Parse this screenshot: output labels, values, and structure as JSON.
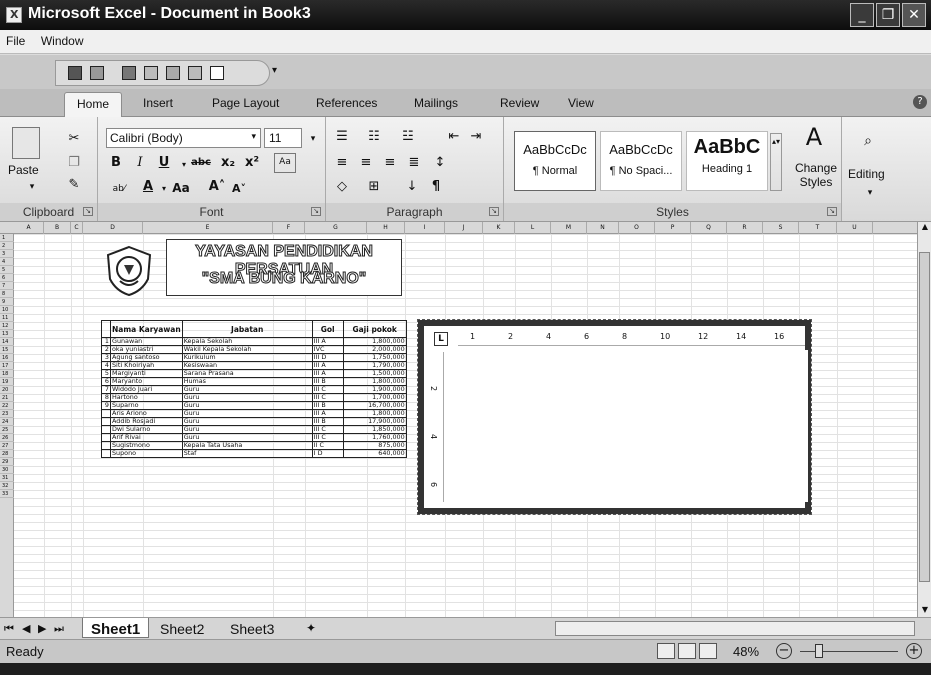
{
  "window": {
    "title": "Microsoft Excel - Document in Book3"
  },
  "menu": [
    "File",
    "Window"
  ],
  "ribbon_tabs": [
    "Home",
    "Insert",
    "Page Layout",
    "References",
    "Mailings",
    "Review",
    "View"
  ],
  "clipboard": {
    "paste": "Paste",
    "label": "Clipboard"
  },
  "font": {
    "name": "Calibri (Body)",
    "size": "11",
    "label": "Font"
  },
  "paragraph": {
    "label": "Paragraph"
  },
  "styles": {
    "items": [
      {
        "sample": "AaBbCcDc",
        "name": "¶ Normal"
      },
      {
        "sample": "AaBbCcDc",
        "name": "¶ No Spaci..."
      },
      {
        "sample": "AaBbC",
        "name": "Heading 1"
      }
    ],
    "change_styles": "Change Styles",
    "label": "Styles"
  },
  "editing": {
    "label": "Editing"
  },
  "columns": [
    "A",
    "B",
    "C",
    "D",
    "E",
    "F",
    "G",
    "H",
    "I",
    "J",
    "K",
    "L",
    "M",
    "N",
    "O",
    "P",
    "Q",
    "R",
    "S",
    "T",
    "U"
  ],
  "banner": {
    "line1": "YAYASAN PENDIDIKAN PERSATUAN",
    "line2": "\"SMA BUNG KARNO\""
  },
  "table": {
    "headers": [
      "",
      "Nama Karyawan",
      "Jabatan",
      "Gol",
      "Gaji pokok"
    ],
    "rows": [
      [
        "1",
        "Gunawan",
        "Kepala Sekolah",
        "III A",
        "1,800,000"
      ],
      [
        "2",
        "oka yuniastri",
        "Wakil Kepala Sekolah",
        "IVC",
        "2,000,000"
      ],
      [
        "3",
        "Agung santoso",
        "Kurikulum",
        "III D",
        "1,750,000"
      ],
      [
        "4",
        "Siti Khoiriyah",
        "Kesiswaan",
        "III A",
        "1,790,000"
      ],
      [
        "5",
        "Margiyanti",
        "Sarana Prasana",
        "III A",
        "1,500,000"
      ],
      [
        "6",
        "Maryanto",
        "Humas",
        "III B",
        "1,800,000"
      ],
      [
        "7",
        "Widodo Juari",
        "Guru",
        "III C",
        "1,900,000"
      ],
      [
        "8",
        "Hartono",
        "Guru",
        "III C",
        "1,700,000"
      ],
      [
        "9",
        "Suparno",
        "Guru",
        "III B",
        "16,700,000"
      ],
      [
        "",
        "Aris Ariono",
        "Guru",
        "III A",
        "1,800,000"
      ],
      [
        "",
        "Addib Rosjadi",
        "Guru",
        "III B",
        "17,900,000"
      ],
      [
        "",
        "Dwi Sularno",
        "Guru",
        "III C",
        "1,850,000"
      ],
      [
        "",
        "Arif Rivai",
        "Guru",
        "III C",
        "1,760,000"
      ],
      [
        "",
        "Sugistmono",
        "Kepala Tata Usaha",
        "II C",
        "875,000"
      ],
      [
        "",
        "Supono",
        "Staf",
        "I D",
        "640,000"
      ]
    ]
  },
  "doc_ruler": {
    "marks": [
      "1",
      "2",
      "4",
      "6",
      "8",
      "10",
      "12",
      "14",
      "16"
    ],
    "vmarks": [
      "2",
      "4",
      "6"
    ]
  },
  "sheet_tabs": [
    "Sheet1",
    "Sheet2",
    "Sheet3"
  ],
  "status": {
    "ready": "Ready",
    "zoom": "48%"
  }
}
